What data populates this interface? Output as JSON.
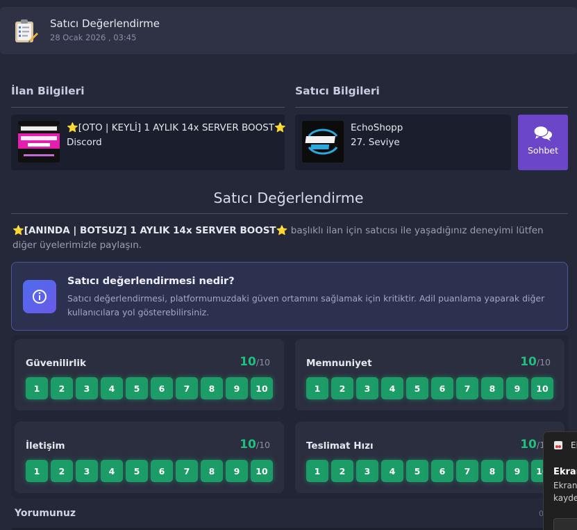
{
  "header": {
    "title": "Satıcı Değerlendirme",
    "date": "28 Ocak 2026 , 03:45"
  },
  "listing": {
    "section_title": "İlan Bilgileri",
    "title": "⭐[OTO | KEYLİ] 1 AYLIK 14x SERVER BOOST⭐",
    "category": "Discord"
  },
  "seller": {
    "section_title": "Satıcı Bilgileri",
    "name": "EchoShopp",
    "level": "27. Seviye",
    "chat_label": "Sohbet"
  },
  "review": {
    "title": "Satıcı Değerlendirme",
    "listing_name": "⭐[ANINDA | BOTSUZ] 1 AYLIK 14x SERVER BOOST⭐",
    "intro_rest": " başlıklı ilan için satıcısı ile yaşadığınız deneyimi lütfen diğer üyelerimizle paylaşın."
  },
  "info": {
    "title": "Satıcı değerlendirmesi nedir?",
    "description": "Satıcı değerlendirmesi, platformumuzdaki güven ortamını sağlamak için kritiktir. Adil puanlama yaparak diğer kullanıcılara yol gösterebilirsiniz."
  },
  "ratings": [
    {
      "label": "Güvenilirlik",
      "score": "10",
      "max": "/10"
    },
    {
      "label": "Memnuniyet",
      "score": "10",
      "max": "/10"
    },
    {
      "label": "İletişim",
      "score": "10",
      "max": "/10"
    },
    {
      "label": "Teslimat Hızı",
      "score": "10",
      "max": "/10"
    }
  ],
  "rating_buttons": [
    "1",
    "2",
    "3",
    "4",
    "5",
    "6",
    "7",
    "8",
    "9",
    "10"
  ],
  "comment": {
    "label": "Yorumunuz",
    "counter": "0"
  },
  "toast": {
    "app": "Ek",
    "title": "Ekran",
    "line1": "Ekran",
    "line2": "kayde"
  },
  "colors": {
    "accent_green": "#1c9c66",
    "chat_purple": "#6c46c9",
    "info_blue": "#4e6cf0"
  }
}
